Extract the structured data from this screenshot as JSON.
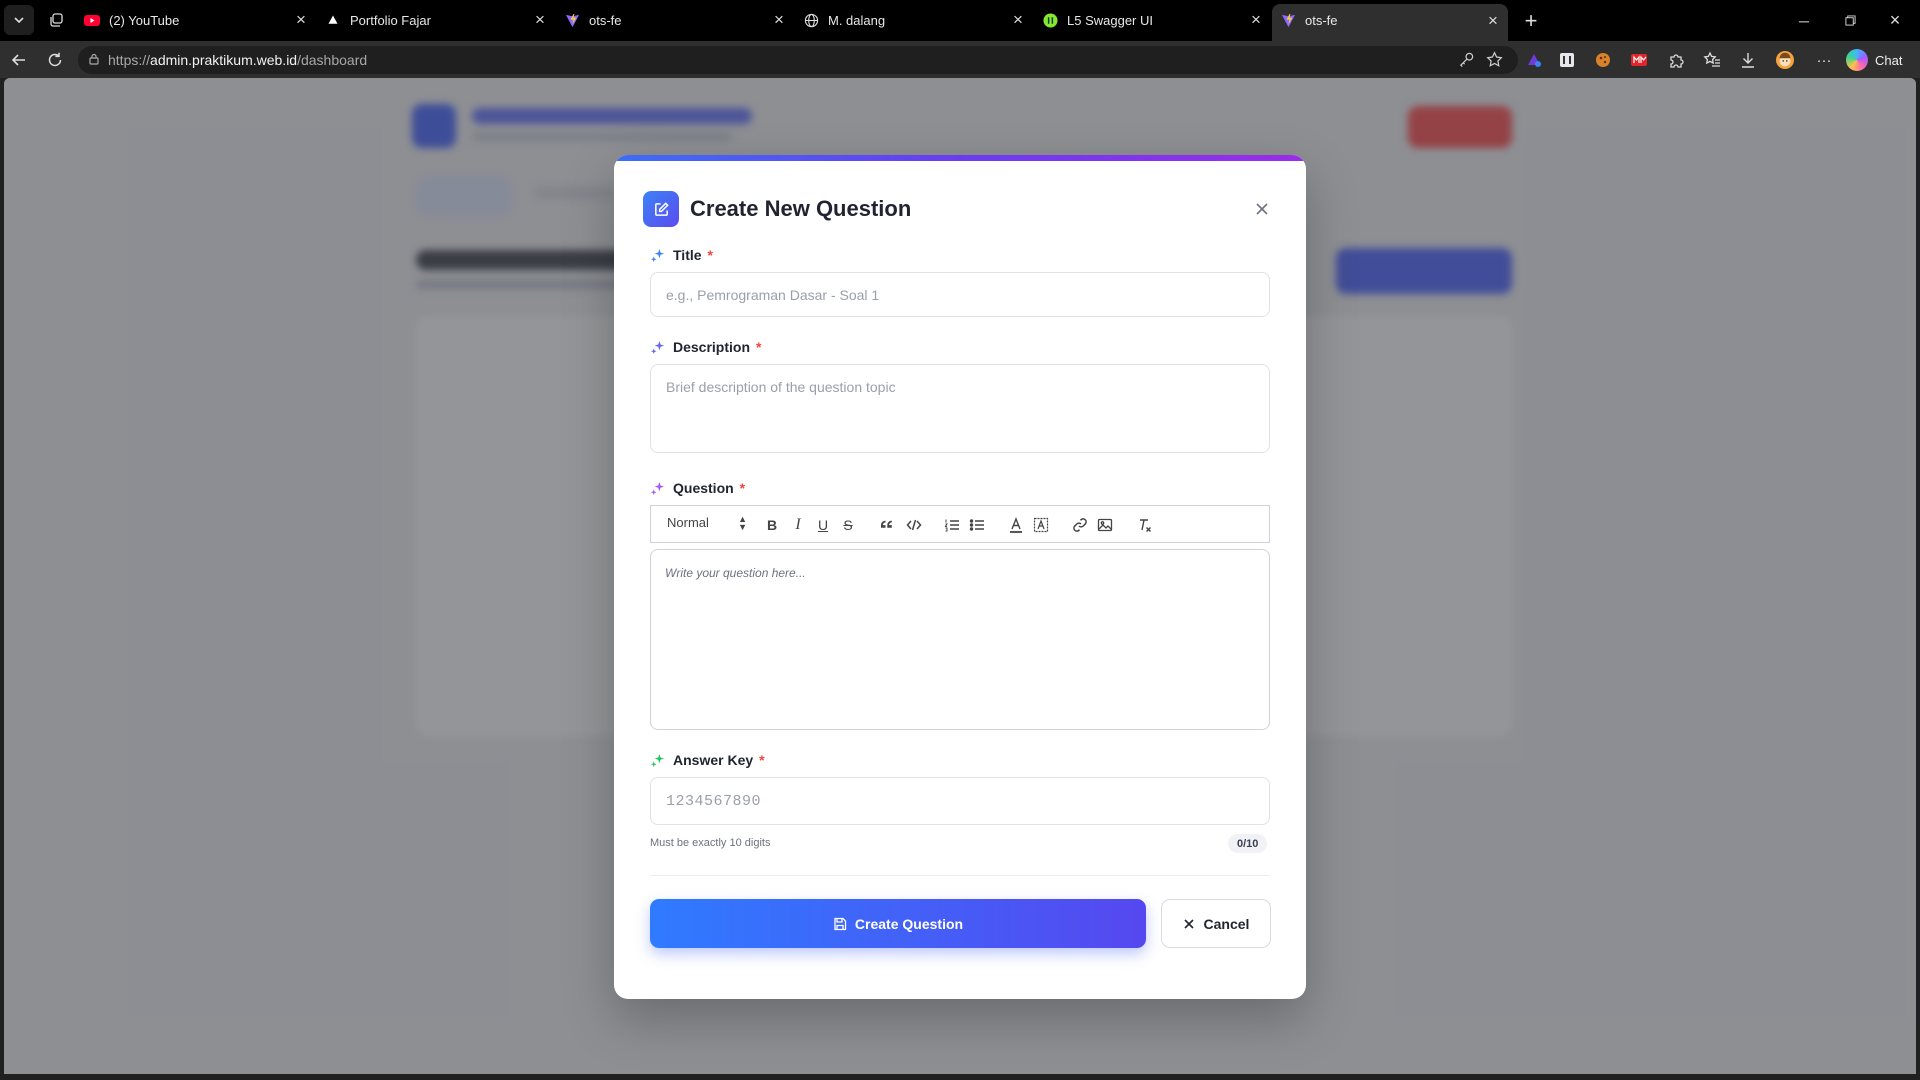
{
  "browser": {
    "tabs": [
      {
        "title": "(2) YouTube",
        "icon": "youtube-icon",
        "active": false
      },
      {
        "title": "Portfolio Fajar",
        "icon": "triangle-icon",
        "active": false
      },
      {
        "title": "ots-fe",
        "icon": "vite-icon",
        "active": false
      },
      {
        "title": "M. dalang",
        "icon": "globe-icon",
        "active": false
      },
      {
        "title": "L5 Swagger UI",
        "icon": "swagger-icon",
        "active": false
      },
      {
        "title": "ots-fe",
        "icon": "vite-icon",
        "active": true
      }
    ],
    "url_prefix": "https://",
    "url_host": "admin.praktikum.web.id",
    "url_path": "/dashboard",
    "chat_label": "Chat"
  },
  "modal": {
    "title": "Create New Question",
    "fields": {
      "title": {
        "label": "Title",
        "required_mark": "*",
        "placeholder": "e.g., Pemrograman Dasar - Soal 1",
        "value": ""
      },
      "description": {
        "label": "Description",
        "required_mark": "*",
        "placeholder": "Brief description of the question topic",
        "value": ""
      },
      "question": {
        "label": "Question",
        "required_mark": "*",
        "format_value": "Normal",
        "placeholder": "Write your question here..."
      },
      "answer_key": {
        "label": "Answer Key",
        "required_mark": "*",
        "placeholder": "1234567890",
        "value": "",
        "hint": "Must be exactly 10 digits",
        "counter": "0/10"
      }
    },
    "buttons": {
      "create": "Create Question",
      "cancel": "Cancel"
    }
  },
  "colors": {
    "accent_start": "#2f7bff",
    "accent_end": "#5548f0",
    "required": "#ef4444",
    "title_icon": "#3b82f6",
    "description_icon": "#6366f1",
    "question_icon": "#a855f7",
    "answer_icon": "#22c55e"
  }
}
